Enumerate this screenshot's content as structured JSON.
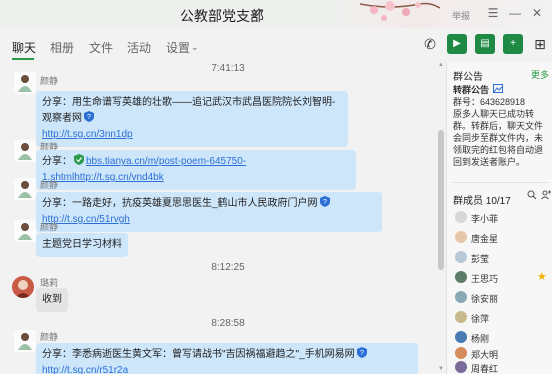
{
  "window": {
    "title": "公教部党支部",
    "report_label": "举报"
  },
  "toolbar": {
    "tabs": [
      {
        "label": "聊天",
        "active": true
      },
      {
        "label": "相册",
        "active": false
      },
      {
        "label": "文件",
        "active": false
      },
      {
        "label": "活动",
        "active": false
      },
      {
        "label": "设置",
        "active": false
      }
    ]
  },
  "chat": {
    "messages": [
      {
        "time": "7:41:13"
      },
      {
        "sender": "颜静",
        "prefix": "分享：用生命谱写英雄的壮歌——追记武汉市武昌医院院长刘智明-观察者网",
        "link": "http://t.sg.cn/3nn1dp"
      },
      {
        "sender": "颜静",
        "prefix": "分享：",
        "link": "bbs.tianya.cn/m/post-poem-645750-1.shtmlhttp://t.sg.cn/vnd4bk"
      },
      {
        "sender": "颜静",
        "prefix": "分享：一路走好，抗疫英雄夏思思医生_鹤山市人民政府门户网",
        "link": "http://t.sg.cn/51rvgh"
      },
      {
        "sender": "颜静",
        "prefix": "主题党日学习材料"
      },
      {
        "time": "8:12:25"
      },
      {
        "sender": "璐莉",
        "prefix": "收到"
      },
      {
        "time": "8:28:58"
      },
      {
        "sender": "颜静",
        "prefix": "分享：李悉病逝医生黄文军：曾写请战书\"吉因祸福避趋之\"_手机网易网",
        "link": "http://t.sg.cn/r51r2a"
      }
    ]
  },
  "announcement": {
    "header": "群公告",
    "more": "更多",
    "title": "转群公告",
    "group_no_label": "群号：",
    "group_no": "643628918",
    "body": "原多人聊天已成功转群。转群后，聊天文件会同步至群文件内，未领取完的红包将自动退回到发送者账户。"
  },
  "members": {
    "header": "群成员",
    "count": "10/17",
    "list": [
      {
        "name": "李小菲",
        "star": false
      },
      {
        "name": "唐金星",
        "star": false
      },
      {
        "name": "彭莹",
        "star": false
      },
      {
        "name": "王思巧",
        "star": true
      },
      {
        "name": "徐安丽",
        "star": false
      },
      {
        "name": "徐萍",
        "star": false
      },
      {
        "name": "杨刚",
        "star": false
      },
      {
        "name": "郑大明",
        "star": false
      },
      {
        "name": "周春红",
        "star": false
      }
    ]
  },
  "colors": {
    "accent": "#2b9a4a",
    "bubble": "#cde6fa",
    "link": "#2b6fd6"
  }
}
